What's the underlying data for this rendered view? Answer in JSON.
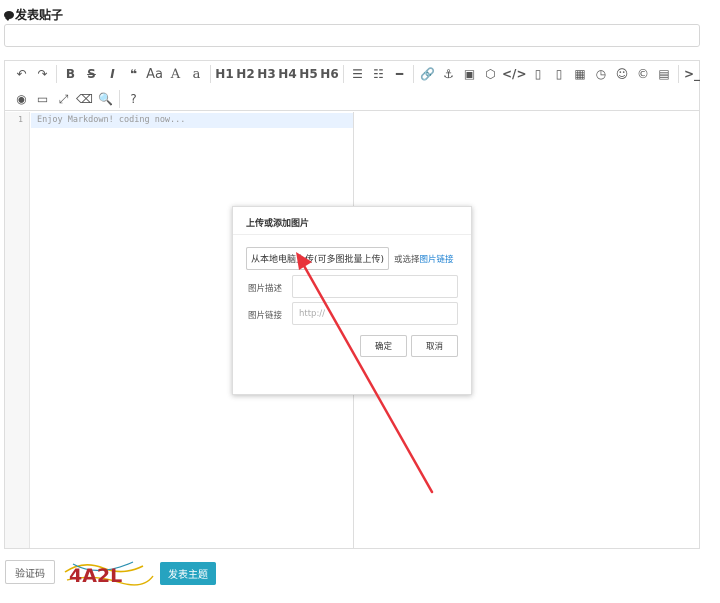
{
  "page": {
    "heading": "发表贴子"
  },
  "toolbar": {
    "row1": [
      {
        "name": "undo-icon",
        "glyph": "↶"
      },
      {
        "name": "redo-icon",
        "glyph": "↷"
      },
      {
        "sep": true
      },
      {
        "name": "bold-icon",
        "text": "B"
      },
      {
        "name": "strikethrough-icon",
        "text": "S"
      },
      {
        "name": "italic-icon",
        "text": "I"
      },
      {
        "name": "quote-icon",
        "text": "❝"
      },
      {
        "name": "uppercase-icon",
        "text": "Aa"
      },
      {
        "name": "capitalize-icon",
        "text": "A"
      },
      {
        "name": "lowercase-icon",
        "text": "a"
      },
      {
        "sep": true
      },
      {
        "name": "h1-button",
        "text": "H1"
      },
      {
        "name": "h2-button",
        "text": "H2"
      },
      {
        "name": "h3-button",
        "text": "H3"
      },
      {
        "name": "h4-button",
        "text": "H4"
      },
      {
        "name": "h5-button",
        "text": "H5"
      },
      {
        "name": "h6-button",
        "text": "H6"
      },
      {
        "sep": true
      },
      {
        "name": "unordered-list-icon",
        "glyph": "☰"
      },
      {
        "name": "ordered-list-icon",
        "glyph": "☷"
      },
      {
        "name": "horizontal-rule-icon",
        "glyph": "━"
      },
      {
        "sep": true
      },
      {
        "name": "link-icon",
        "glyph": "🔗"
      },
      {
        "name": "anchor-icon",
        "glyph": "⚓"
      },
      {
        "name": "image-icon",
        "glyph": "▣"
      },
      {
        "name": "code-block-icon",
        "glyph": "⬡"
      },
      {
        "name": "inline-code-icon",
        "text": "</>"
      },
      {
        "name": "preformatted-icon",
        "glyph": "▯"
      },
      {
        "name": "code-file-icon",
        "glyph": "▯"
      },
      {
        "name": "table-icon",
        "glyph": "▦"
      },
      {
        "name": "datetime-icon",
        "glyph": "◷"
      },
      {
        "name": "emoji-icon",
        "glyph": "☺"
      },
      {
        "name": "html-entities-icon",
        "glyph": "©"
      },
      {
        "name": "pagebreak-icon",
        "glyph": "▤"
      },
      {
        "sep": true
      },
      {
        "name": "goto-line-icon",
        "text": ">_"
      }
    ],
    "row2": [
      {
        "name": "watch-toggle-icon",
        "glyph": "◉"
      },
      {
        "name": "preview-icon",
        "glyph": "▭"
      },
      {
        "name": "fullscreen-icon",
        "glyph": "⤢"
      },
      {
        "name": "clear-icon",
        "glyph": "⌫"
      },
      {
        "name": "search-icon",
        "glyph": "🔍"
      },
      {
        "sep": true
      },
      {
        "name": "help-icon",
        "glyph": "?"
      }
    ]
  },
  "editor": {
    "line_number": "1",
    "placeholder": "Enjoy Markdown! coding now..."
  },
  "dialog": {
    "title": "上传或添加图片",
    "upload_label": "从本地电脑上传(可多图批量上传)",
    "or_text": "或选择",
    "image_link_text": "图片链接",
    "desc_label": "图片描述",
    "desc_value": "",
    "link_label": "图片链接",
    "link_placeholder": "http://",
    "ok_label": "确定",
    "cancel_label": "取消"
  },
  "footer": {
    "captcha_label": "验证码",
    "captcha_text": "4A2L",
    "submit_label": "发表主题"
  },
  "colors": {
    "accent": "#26a3c0",
    "arrow": "#e8333b",
    "link": "#1a7fd1"
  }
}
